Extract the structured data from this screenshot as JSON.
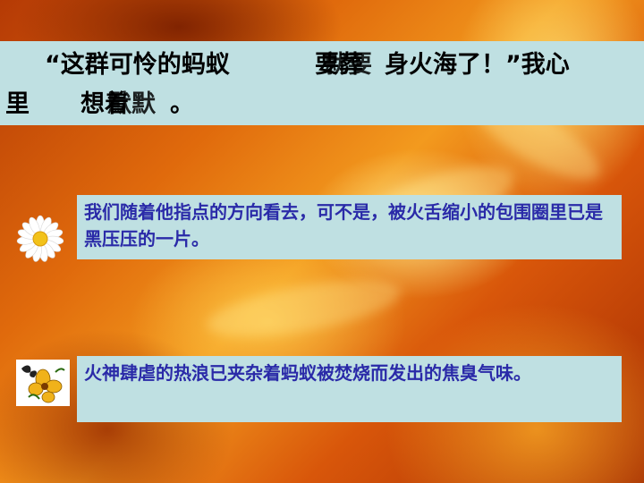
{
  "slide": {
    "title": {
      "line1_start": "“这群可怜的蚂蚁",
      "line1_overlap_a": "要葬",
      "line1_overlap_b": "就要",
      "line1_end": "身火海了！”我心",
      "line2_start": "里",
      "line2_overlap_a": "想着",
      "line2_overlap_b": "默默",
      "line2_end": "。"
    },
    "passage1": "我们随着他指点的方向看去，可不是，被火舌缩小的包围圈里已是黑压压的一片。",
    "passage2": "火神肆虐的热浪已夹杂着蚂蚁被焚烧而发出的焦臭气味。",
    "icons": [
      "daisy-icon",
      "butterfly-flower-icon"
    ],
    "colors": {
      "box_bg": "#bfe0e2",
      "passage_text": "#2a2aa8",
      "title_text": "#000000"
    }
  }
}
